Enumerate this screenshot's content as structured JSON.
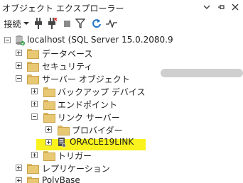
{
  "title_bar": {
    "title": "オブジェクト エクスプローラー",
    "dropdown_icon": "chevron-down-icon",
    "pin_icon": "pin-icon",
    "close_icon": "close-icon"
  },
  "toolbar": {
    "connect_label": "接続",
    "items": [
      "connect-dropdown",
      "connect-plug-icon",
      "disconnect-icon",
      "stop-icon",
      "filter-icon",
      "refresh-icon",
      "activity-monitor-icon"
    ]
  },
  "tree": {
    "root": {
      "label": "localhost (SQL Server 15.0.2080.9",
      "icon": "server-icon",
      "expanded": true
    },
    "nodes": [
      {
        "label": "データベース",
        "expanded": false
      },
      {
        "label": "セキュリティ",
        "expanded": false
      },
      {
        "label": "サーバー オブジェクト",
        "expanded": true
      },
      {
        "label": "バックアップ デバイス",
        "expanded": false
      },
      {
        "label": "エンドポイント",
        "expanded": false
      },
      {
        "label": "リンク サーバー",
        "expanded": true
      },
      {
        "label": "プロバイダー",
        "expanded": false
      },
      {
        "label": "ORACLE19LINK",
        "expanded": false,
        "highlighted": true
      },
      {
        "label": "トリガー",
        "expanded": false
      },
      {
        "label": "レプリケーション",
        "expanded": false
      },
      {
        "label": "PolyBase",
        "expanded": false
      }
    ]
  },
  "colors": {
    "highlight": "#f9f21d",
    "folder": "#e8c873",
    "refresh": "#1e73c8"
  }
}
